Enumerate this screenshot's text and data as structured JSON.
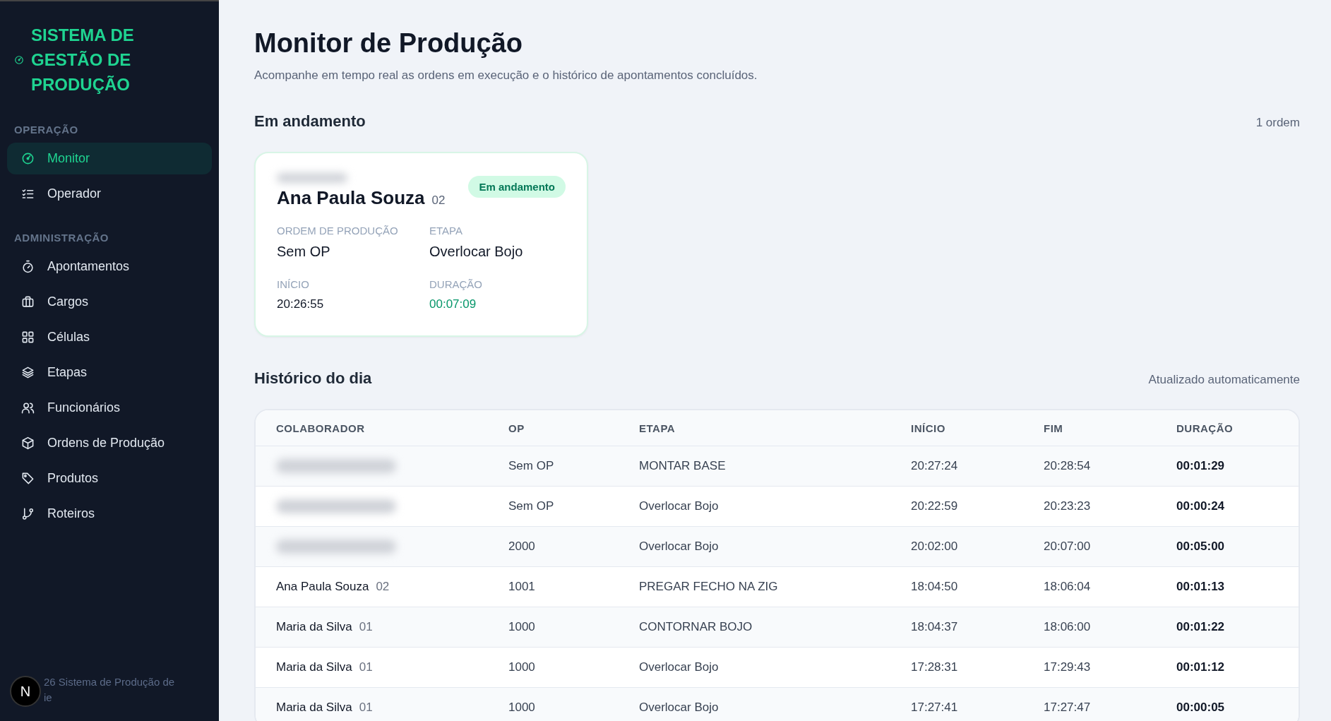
{
  "sidebar": {
    "logo": "SISTEMA DE GESTÃO DE PRODUÇÃO",
    "sections": [
      {
        "title": "OPERAÇÃO",
        "items": [
          {
            "label": "Monitor",
            "selected": true
          },
          {
            "label": "Operador",
            "selected": false
          }
        ]
      },
      {
        "title": "ADMINISTRAÇÃO",
        "items": [
          {
            "label": "Apontamentos",
            "selected": false
          },
          {
            "label": "Cargos",
            "selected": false
          },
          {
            "label": "Células",
            "selected": false
          },
          {
            "label": "Etapas",
            "selected": false
          },
          {
            "label": "Funcionários",
            "selected": false
          },
          {
            "label": "Ordens de Produção",
            "selected": false
          },
          {
            "label": "Produtos",
            "selected": false
          },
          {
            "label": "Roteiros",
            "selected": false
          }
        ]
      }
    ],
    "footer": [
      "26 Sistema de Produção de",
      "ie"
    ],
    "dev_badge": "N"
  },
  "page": {
    "title": "Monitor de Produção",
    "subtitle": "Acompanhe em tempo real as ordens em execução e o histórico de apontamentos concluídos."
  },
  "in_progress": {
    "title": "Em andamento",
    "count": "1 ordem",
    "cards": [
      {
        "redacted": true,
        "name": "Ana Paula Souza",
        "code": "02",
        "status": "Em andamento",
        "fields": [
          {
            "label": "ORDEM DE PRODUÇÃO",
            "value": "Sem OP",
            "kind": "plain"
          },
          {
            "label": "ETAPA",
            "value": "Overlocar Bojo",
            "kind": "plain"
          },
          {
            "label": "INÍCIO",
            "value": "20:26:55",
            "kind": "time"
          },
          {
            "label": "DURAÇÃO",
            "value": "00:07:09",
            "kind": "elapsed"
          }
        ]
      }
    ]
  },
  "history": {
    "title": "Histórico do dia",
    "note": "Atualizado automaticamente",
    "columns": [
      "COLABORADOR",
      "OP",
      "ETAPA",
      "INÍCIO",
      "FIM",
      "DURAÇÃO"
    ],
    "rows": [
      {
        "redacted": true,
        "op": "Sem OP",
        "stage": "MONTAR BASE",
        "start": "20:27:24",
        "end": "20:28:54",
        "duration": "00:01:29"
      },
      {
        "redacted": true,
        "op": "Sem OP",
        "stage": "Overlocar Bojo",
        "start": "20:22:59",
        "end": "20:23:23",
        "duration": "00:00:24"
      },
      {
        "redacted": true,
        "op": "2000",
        "stage": "Overlocar Bojo",
        "start": "20:02:00",
        "end": "20:07:00",
        "duration": "00:05:00"
      },
      {
        "redacted": false,
        "name": "Ana Paula Souza",
        "code": "02",
        "op": "1001",
        "stage": "PREGAR FECHO NA ZIG",
        "start": "18:04:50",
        "end": "18:06:04",
        "duration": "00:01:13"
      },
      {
        "redacted": false,
        "name": "Maria da Silva",
        "code": "01",
        "op": "1000",
        "stage": "CONTORNAR BOJO",
        "start": "18:04:37",
        "end": "18:06:00",
        "duration": "00:01:22"
      },
      {
        "redacted": false,
        "name": "Maria da Silva",
        "code": "01",
        "op": "1000",
        "stage": "Overlocar Bojo",
        "start": "17:28:31",
        "end": "17:29:43",
        "duration": "00:01:12"
      },
      {
        "redacted": false,
        "name": "Maria da Silva",
        "code": "01",
        "op": "1000",
        "stage": "Overlocar Bojo",
        "start": "17:27:41",
        "end": "17:27:47",
        "duration": "00:00:05"
      }
    ]
  }
}
